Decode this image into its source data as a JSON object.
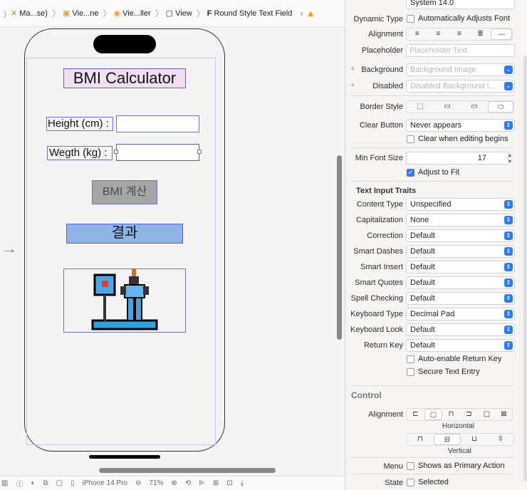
{
  "breadcrumbs": [
    {
      "icon": "x-icon",
      "label": "Ma...se)"
    },
    {
      "icon": "folder-icon",
      "label": "Vie...ne"
    },
    {
      "icon": "circle-icon",
      "label": "Vie...ller"
    },
    {
      "icon": "view-icon",
      "label": "View"
    },
    {
      "icon": "f-icon",
      "label": "Round Style Text Field"
    }
  ],
  "canvas": {
    "title": "BMI Calculator",
    "height_label": "Height (cm) :",
    "weight_label": "Wegth (kg) :",
    "calc_button": "BMI 계산",
    "result_label": "결과",
    "entry_arrow": "→"
  },
  "bottom_bar": {
    "device": "iPhone 14 Pro",
    "zoom": "71%"
  },
  "inspector": {
    "font_value": "System 14.0",
    "dynamic_type": {
      "label": "Dynamic Type",
      "checkbox": "Automatically Adjusts Font",
      "checked": false
    },
    "alignment_label": "Alignment",
    "placeholder": {
      "label": "Placeholder",
      "value": "Placeholder Text"
    },
    "background": {
      "label": "Background",
      "value": "Background Image"
    },
    "disabled": {
      "label": "Disabled",
      "value": "Disabled Background I..."
    },
    "border_style_label": "Border Style",
    "clear_button": {
      "label": "Clear Button",
      "value": "Never appears"
    },
    "clear_when_editing": "Clear when editing begins",
    "min_font_size": {
      "label": "Min Font Size",
      "value": "17"
    },
    "adjust_to_fit": "Adjust to Fit",
    "traits_header": "Text Input Traits",
    "traits": [
      {
        "label": "Content Type",
        "value": "Unspecified"
      },
      {
        "label": "Capitalization",
        "value": "None"
      },
      {
        "label": "Correction",
        "value": "Default"
      },
      {
        "label": "Smart Dashes",
        "value": "Default"
      },
      {
        "label": "Smart Insert",
        "value": "Default"
      },
      {
        "label": "Smart Quotes",
        "value": "Default"
      },
      {
        "label": "Spell Checking",
        "value": "Default"
      },
      {
        "label": "Keyboard Type",
        "value": "Decimal Pad"
      },
      {
        "label": "Keyboard Look",
        "value": "Default"
      },
      {
        "label": "Return Key",
        "value": "Default"
      }
    ],
    "auto_enable_return": "Auto-enable Return Key",
    "secure_text": "Secure Text Entry",
    "control_header": "Control",
    "control_alignment_label": "Alignment",
    "horizontal_caption": "Horizontal",
    "vertical_caption": "Vertical",
    "menu": {
      "label": "Menu",
      "checkbox": "Shows as Primary Action"
    },
    "state": {
      "label": "State",
      "checkbox": "Selected"
    }
  },
  "colors": {
    "accent": "#2f7bf6",
    "selection": "#6f6fd6",
    "title_bg": "#f1dff5",
    "result_bg": "#8fb4e6",
    "button_bg": "#a6a6a6"
  }
}
